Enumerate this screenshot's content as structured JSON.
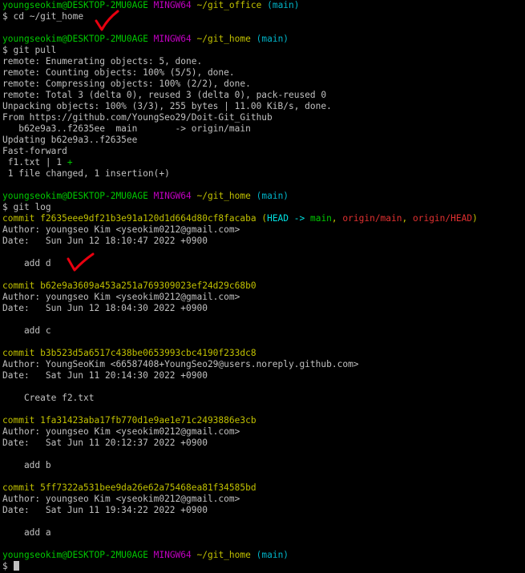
{
  "colors": {
    "background": "#000000",
    "text": "#c0c0c0",
    "user": "#00c800",
    "system": "#c000c0",
    "path": "#c0c000",
    "branch": "#00b4c8",
    "remote_ref": "#e03030",
    "checkmark": "#e8000f"
  },
  "prompt": {
    "user_host": "youngseokim@DESKTOP-2MU0AGE",
    "system": "MINGW64",
    "path_office": "~/git_office",
    "path_home": "~/git_home",
    "branch": "(main)",
    "symbol": "$"
  },
  "commands": {
    "cd": "cd ~/git_home",
    "pull": "git pull",
    "log": "git log"
  },
  "pull_output": [
    "remote: Enumerating objects: 5, done.",
    "remote: Counting objects: 100% (5/5), done.",
    "remote: Compressing objects: 100% (2/2), done.",
    "remote: Total 3 (delta 0), reused 3 (delta 0), pack-reused 0",
    "Unpacking objects: 100% (3/3), 255 bytes | 11.00 KiB/s, done.",
    "From https://github.com/YoungSeo29/Doit-Git_Github",
    "   b62e9a3..f2635ee  main       -> origin/main",
    "Updating b62e9a3..f2635ee",
    "Fast-forward"
  ],
  "diffstat": {
    "file_line": " f1.txt | 1 ",
    "plus": "+",
    "summary": " 1 file changed, 1 insertion(+)"
  },
  "head_refs": {
    "open": "(",
    "head": "HEAD -> ",
    "main": "main",
    "sep1": ", ",
    "origin_main": "origin/main",
    "sep2": ", ",
    "origin_head": "origin/HEAD",
    "close": ")"
  },
  "commits": [
    {
      "commit": "commit f2635eee9df21b3e91a120d1d664d80cf8facaba",
      "author": "Author: youngseo Kim <yseokim0212@gmail.com>",
      "date": "Date:   Sun Jun 12 18:10:47 2022 +0900",
      "message": "    add d"
    },
    {
      "commit": "commit b62e9a3609a453a251a769309023ef24d29c68b0",
      "author": "Author: youngseo Kim <yseokim0212@gmail.com>",
      "date": "Date:   Sun Jun 12 18:04:30 2022 +0900",
      "message": "    add c"
    },
    {
      "commit": "commit b3b523d5a6517c438be0653993cbc4190f233dc8",
      "author": "Author: YoungSeoKim <66587408+YoungSeo29@users.noreply.github.com>",
      "date": "Date:   Sat Jun 11 20:14:30 2022 +0900",
      "message": "    Create f2.txt"
    },
    {
      "commit": "commit 1fa31423aba17fb770d1e9ae1e71c2493886e3cb",
      "author": "Author: youngseo Kim <yseokim0212@gmail.com>",
      "date": "Date:   Sat Jun 11 20:12:37 2022 +0900",
      "message": "    add b"
    },
    {
      "commit": "commit 5ff7322a531bee9da26e62a75468ea81f34585bd",
      "author": "Author: youngseo Kim <yseokim0212@gmail.com>",
      "date": "Date:   Sat Jun 11 19:34:22 2022 +0900",
      "message": "    add a"
    }
  ]
}
